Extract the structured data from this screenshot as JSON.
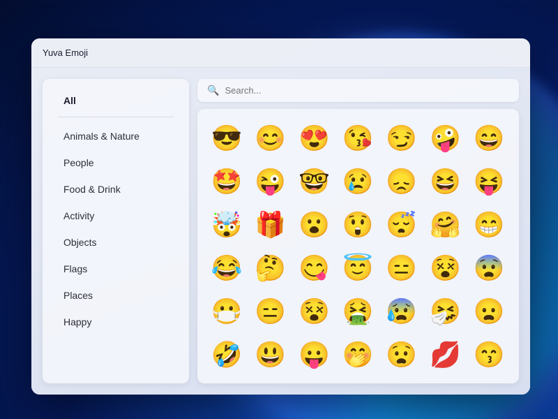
{
  "window": {
    "title": "Yuva Emoji"
  },
  "search": {
    "placeholder": "Search..."
  },
  "sidebar": {
    "items": [
      {
        "id": "all",
        "label": "All",
        "active": true
      },
      {
        "id": "animals",
        "label": "Animals & Nature",
        "active": false
      },
      {
        "id": "people",
        "label": "People",
        "active": false
      },
      {
        "id": "food",
        "label": "Food & Drink",
        "active": false
      },
      {
        "id": "activity",
        "label": "Activity",
        "active": false
      },
      {
        "id": "objects",
        "label": "Objects",
        "active": false
      },
      {
        "id": "flags",
        "label": "Flags",
        "active": false
      },
      {
        "id": "places",
        "label": "Places",
        "active": false
      },
      {
        "id": "happy",
        "label": "Happy",
        "active": false
      }
    ]
  },
  "emojis": [
    "😎",
    "😊",
    "😍",
    "😘",
    "😏",
    "🤪",
    "😄",
    "🤩",
    "😜",
    "🤓",
    "😢",
    "😞",
    "😆",
    "😝",
    "🤯",
    "🎁",
    "😮",
    "😲",
    "😴",
    "🤗",
    "😁",
    "😂",
    "🤔",
    "😋",
    "😇",
    "😑",
    "😵",
    "😨",
    "😷",
    "😑",
    "😵",
    "🤮",
    "😰",
    "🤧",
    "😦",
    "🤣",
    "😃",
    "😛",
    "🤭",
    "😧",
    "💋",
    "😙"
  ],
  "colors": {
    "accent": "#2563eb",
    "background": "#0a2a6e"
  }
}
